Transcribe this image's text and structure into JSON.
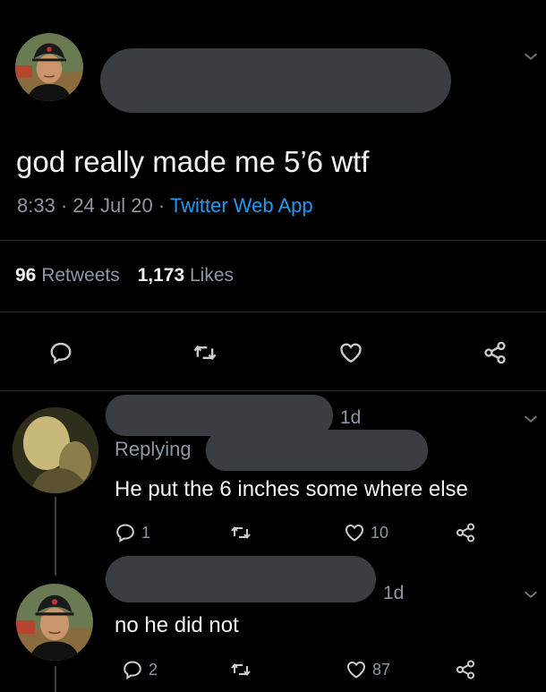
{
  "tweet": {
    "text": "god really made me 5’6 wtf",
    "time": "8:33",
    "sep1": "·",
    "date": "24 Jul 20",
    "sep2": "·",
    "source": "Twitter Web App",
    "retweets_count": "96",
    "retweets_label": "Retweets",
    "likes_count": "1,173",
    "likes_label": "Likes"
  },
  "replies": [
    {
      "age": "1d",
      "replying_prefix": "Replying",
      "text": "He put the 6 inches some where else",
      "reply_count": "1",
      "like_count": "10"
    },
    {
      "age": "1d",
      "text": "no he did not",
      "reply_count": "2",
      "like_count": "87"
    }
  ],
  "icons": {
    "reply": "reply-icon",
    "retweet": "retweet-icon",
    "like": "heart-icon",
    "share": "share-icon",
    "more": "chevron-down-icon"
  },
  "colors": {
    "background": "#000000",
    "text": "#e7e9ea",
    "muted": "#8b98a5",
    "link": "#1d9bf0",
    "redaction": "#3a3d42"
  }
}
